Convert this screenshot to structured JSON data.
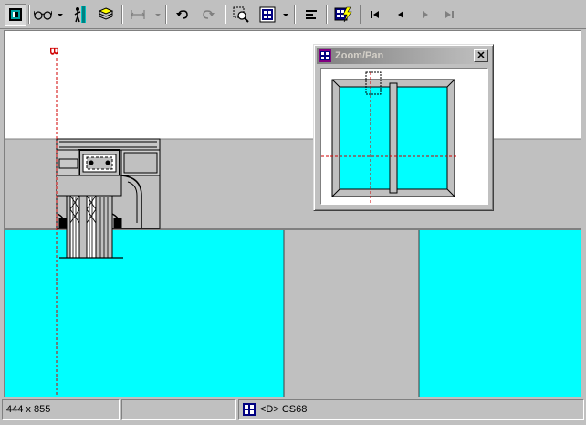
{
  "toolbar": {
    "buttons": [
      {
        "name": "frame-view-icon",
        "enabled": true,
        "pressed": true
      },
      {
        "name": "glasses-icon",
        "enabled": true
      },
      {
        "name": "person-icon",
        "enabled": true
      },
      {
        "name": "layers-icon",
        "enabled": true
      },
      {
        "name": "dimension-icon",
        "enabled": false
      },
      {
        "name": "undo-icon",
        "enabled": true
      },
      {
        "name": "redo-icon",
        "enabled": false
      },
      {
        "name": "zoom-window-icon",
        "enabled": true
      },
      {
        "name": "grid-window-icon",
        "enabled": true
      },
      {
        "name": "align-left-icon",
        "enabled": true
      },
      {
        "name": "flash-grid-icon",
        "enabled": true
      },
      {
        "name": "first-record-icon",
        "enabled": true
      },
      {
        "name": "previous-record-icon",
        "enabled": true
      },
      {
        "name": "next-record-icon",
        "enabled": false
      },
      {
        "name": "last-record-icon",
        "enabled": false
      }
    ]
  },
  "canvas": {
    "section_label": "B",
    "colors": {
      "glass": "#00ffff",
      "frame": "#c0c0c0",
      "section_line": "#d00000"
    }
  },
  "zoom_pan": {
    "title": "Zoom/Pan",
    "close_label": "✕"
  },
  "status": {
    "dimensions": "444 x 855",
    "empty_panel": "",
    "profile": "<D> CS68"
  }
}
